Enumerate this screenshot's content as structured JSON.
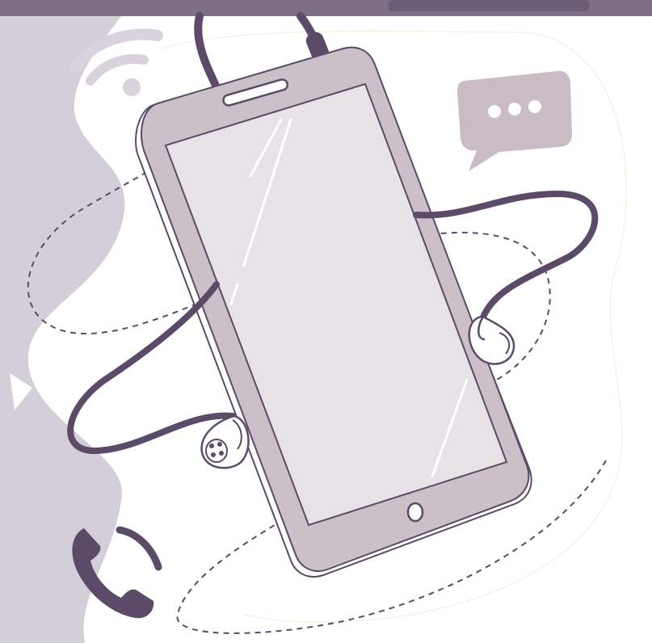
{
  "illustration": {
    "subject": "smartphone-with-earphones",
    "icons": [
      "wifi-icon",
      "chat-bubble-icon",
      "phone-call-icon",
      "earbud-icon"
    ]
  },
  "colors": {
    "background": "#ffffff",
    "top_bar": "#7e6f86",
    "backdrop_shape": "#d4ced9",
    "phone_body": "#cbbfc8",
    "phone_screen": "#e7e2e6",
    "outline": "#5b4a68",
    "cable": "#5b4a68",
    "accent_light": "#d9d2dc",
    "bubble": "#c9bcc5"
  }
}
